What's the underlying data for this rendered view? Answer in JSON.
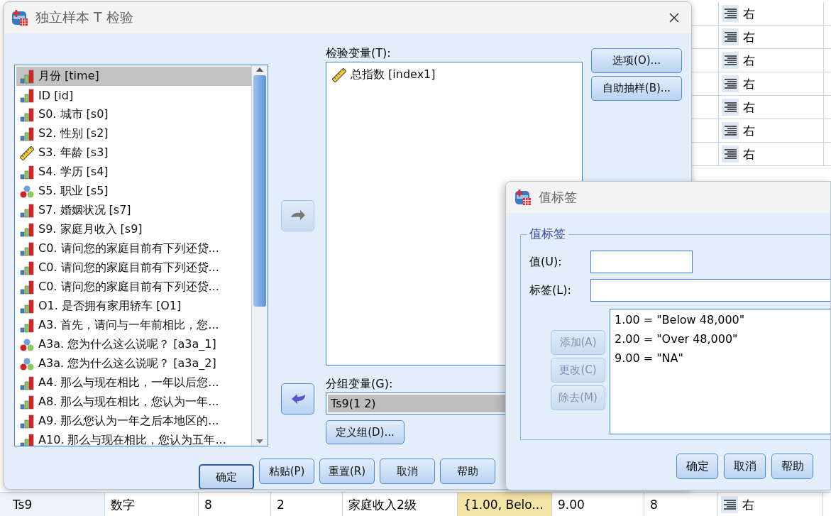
{
  "data_grid": {
    "align_column": [
      "右",
      "右",
      "右",
      "右",
      "右",
      "右",
      "右"
    ],
    "bottom_row": {
      "cells": [
        {
          "text": "Ts9",
          "selected": false
        },
        {
          "text": "数字",
          "selected": false
        },
        {
          "text": "8",
          "selected": false
        },
        {
          "text": "2",
          "selected": false
        },
        {
          "text": "家庭收入2级",
          "selected": false
        },
        {
          "text": "{1.00, Belo...",
          "selected": true
        },
        {
          "text": "9.00",
          "selected": false
        },
        {
          "text": "8",
          "selected": false
        }
      ],
      "align": "右"
    }
  },
  "main_dialog": {
    "title": "独立样本 T 检验",
    "variables": [
      {
        "label": "月份 [time]",
        "kind": "ordinal",
        "selected": true
      },
      {
        "label": "ID [id]",
        "kind": "ordinal",
        "selected": false
      },
      {
        "label": "S0. 城市 [s0]",
        "kind": "ordinal",
        "selected": false
      },
      {
        "label": "S2. 性别 [s2]",
        "kind": "ordinal",
        "selected": false
      },
      {
        "label": "S3. 年龄 [s3]",
        "kind": "scale",
        "selected": false
      },
      {
        "label": "S4. 学历 [s4]",
        "kind": "ordinal",
        "selected": false
      },
      {
        "label": "S5. 职业 [s5]",
        "kind": "nominal",
        "selected": false
      },
      {
        "label": "S7. 婚姻状况 [s7]",
        "kind": "ordinal",
        "selected": false
      },
      {
        "label": "S9. 家庭月收入 [s9]",
        "kind": "ordinal",
        "selected": false
      },
      {
        "label": "C0. 请问您的家庭目前有下列还贷...",
        "kind": "ordinal",
        "selected": false
      },
      {
        "label": "C0. 请问您的家庭目前有下列还贷...",
        "kind": "ordinal",
        "selected": false
      },
      {
        "label": "C0. 请问您的家庭目前有下列还贷...",
        "kind": "ordinal",
        "selected": false
      },
      {
        "label": "O1. 是否拥有家用轿车 [O1]",
        "kind": "ordinal",
        "selected": false
      },
      {
        "label": "A3. 首先，请问与一年前相比，您...",
        "kind": "ordinal",
        "selected": false
      },
      {
        "label": "A3a. 您为什么这么说呢？ [a3a_1]",
        "kind": "nominal",
        "selected": false
      },
      {
        "label": "A3a. 您为什么这么说呢？ [a3a_2]",
        "kind": "nominal",
        "selected": false
      },
      {
        "label": "A4. 那么与现在相比，一年以后您...",
        "kind": "ordinal",
        "selected": false
      },
      {
        "label": "A8. 那么与现在相比，您认为一年...",
        "kind": "ordinal",
        "selected": false
      },
      {
        "label": "A9. 那么您认为一年之后本地区的...",
        "kind": "ordinal",
        "selected": false
      },
      {
        "label": "A10. 那么与现在相比，您认为五年...",
        "kind": "ordinal",
        "selected": false
      }
    ],
    "move_buttons": [
      {
        "kind": "right",
        "disabled": true
      },
      {
        "kind": "left",
        "disabled": false
      }
    ],
    "test_variables_label": "检验变量(T):",
    "test_variables": [
      {
        "label": "总指数 [index1]",
        "kind": "scale"
      }
    ],
    "side_buttons": [
      "选项(O)...",
      "自助抽样(B)..."
    ],
    "grouping_label": "分组变量(G):",
    "grouping": {
      "value": "Ts9(1 2)",
      "selected": true
    },
    "define_groups_button": "定义组(D)...",
    "footer_buttons": [
      {
        "label": "确定",
        "default": true
      },
      {
        "label": "粘贴(P)",
        "default": false
      },
      {
        "label": "重置(R)",
        "default": false
      },
      {
        "label": "取消",
        "default": false
      },
      {
        "label": "帮助",
        "default": false
      }
    ]
  },
  "value_labels_dialog": {
    "title": "值标签",
    "group_title": "值标签",
    "value_field_label": "值(U):",
    "label_field_label": "标签(L):",
    "entries": [
      "1.00 = \"Below 48,000\"",
      "2.00 = \"Over 48,000\"",
      "9.00 = \"NA\""
    ],
    "action_buttons": [
      {
        "label": "添加(A)",
        "disabled": true
      },
      {
        "label": "更改(C)",
        "disabled": true
      },
      {
        "label": "除去(M)",
        "disabled": true
      }
    ],
    "footer_buttons": [
      "确定",
      "取消",
      "帮助"
    ]
  }
}
